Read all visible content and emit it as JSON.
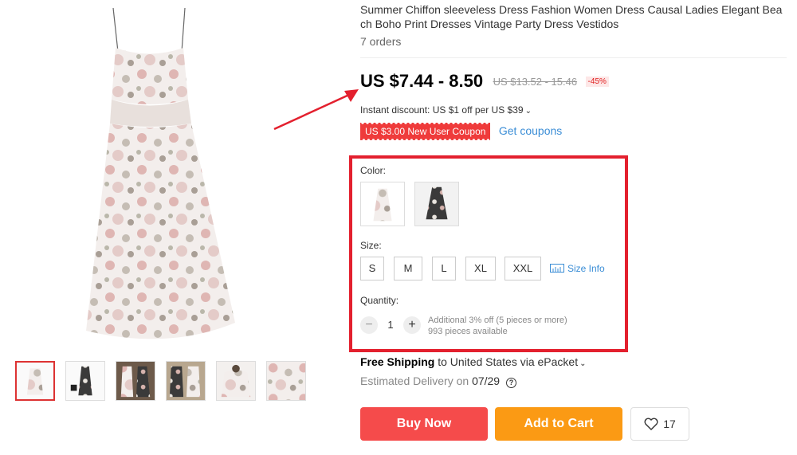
{
  "product": {
    "title": "Summer Chiffon sleeveless Dress Fashion Women Dress Causal Ladies Elegant Beach Boho Print Dresses Vintage Party Dress Vestidos",
    "orders": "7 orders"
  },
  "price": {
    "current": "US $7.44 - 8.50",
    "original": "US $13.52 - 15.46",
    "discount": "-45%"
  },
  "instant_discount": "Instant discount: US $1 off per US $39",
  "coupon": {
    "badge": "US $3.00 New User Coupon",
    "link": "Get coupons"
  },
  "color": {
    "label": "Color:",
    "options": [
      "white-floral-dress",
      "dark-floral-dress"
    ]
  },
  "size": {
    "label": "Size:",
    "options": [
      "S",
      "M",
      "L",
      "XL",
      "XXL"
    ],
    "info": "Size Info"
  },
  "quantity": {
    "label": "Quantity:",
    "value": "1",
    "minus": "−",
    "plus": "+",
    "note_discount": "Additional 3% off (5 pieces or more)",
    "note_available": "993 pieces available"
  },
  "shipping": {
    "free": "Free Shipping",
    "dest": "to United States via ePacket"
  },
  "delivery": {
    "label": "Estimated Delivery on",
    "date": "07/29"
  },
  "actions": {
    "buy_now": "Buy Now",
    "add_to_cart": "Add to Cart",
    "wishlist_count": "17"
  },
  "colors": {
    "highlight": "#e3202e",
    "buy_now": "#f54b4b",
    "add_to_cart": "#fb9a14",
    "link": "#3a8dd6",
    "coupon": "#ef3b3b"
  }
}
